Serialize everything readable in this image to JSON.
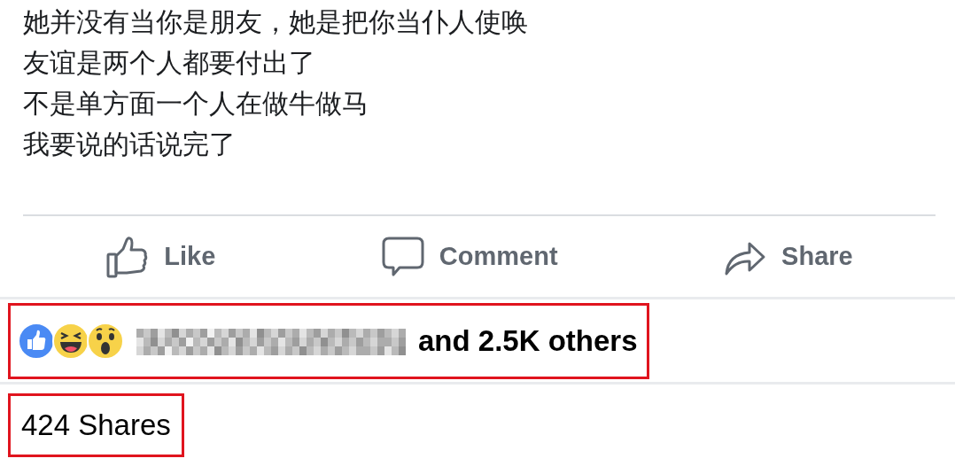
{
  "post_text": [
    "她并没有当你是朋友，她是把你当仆人使唤",
    "友谊是两个人都要付出了",
    "不是单方面一个人在做牛做马",
    "我要说的话说完了"
  ],
  "actions": [
    {
      "kind": "like",
      "label": "Like"
    },
    {
      "kind": "comment",
      "label": "Comment"
    },
    {
      "kind": "share",
      "label": "Share"
    }
  ],
  "reactions": {
    "highlighted": true,
    "types": [
      {
        "kind": "like"
      },
      {
        "kind": "haha"
      },
      {
        "kind": "wow"
      }
    ],
    "names_redacted": true,
    "summary": "and 2.5K others"
  },
  "shares": {
    "highlighted": true,
    "label": "424 Shares"
  }
}
